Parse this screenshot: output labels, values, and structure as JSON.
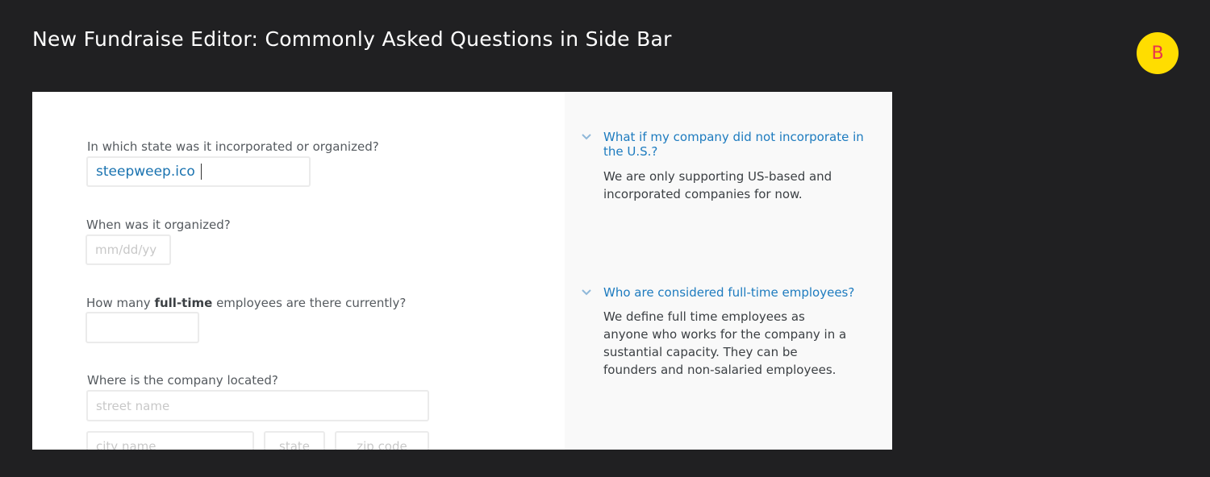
{
  "header": {
    "title": "New Fundraise Editor: Commonly Asked Questions in Side Bar",
    "badge": "B"
  },
  "form": {
    "state_question": "In which state was it incorporated or organized?",
    "state_value": "steepweep.ico",
    "date_question": "When was it organized?",
    "date_placeholder": "mm/dd/yy",
    "employees_question_prefix": "How many ",
    "employees_question_bold": "full-time",
    "employees_question_suffix": " employees are there currently?",
    "location_question": "Where is the company located?",
    "street_placeholder": "street name",
    "city_placeholder": "city name",
    "state_placeholder": "state",
    "zip_placeholder": "zip code"
  },
  "sidebar": {
    "faqs": [
      {
        "question": "What if my company did not incorporate in the U.S.?",
        "answer": "We are only supporting US-based and incorporated companies for now."
      },
      {
        "question": "Who are considered full-time employees?",
        "answer": "We define full time employees as anyone who works for the company in a sustantial capacity. They can be founders and non-salaried employees."
      }
    ]
  },
  "colors": {
    "background": "#202022",
    "badge_bg": "#ffdd00",
    "badge_text": "#e8344e",
    "link_blue": "#1d7bbf"
  }
}
